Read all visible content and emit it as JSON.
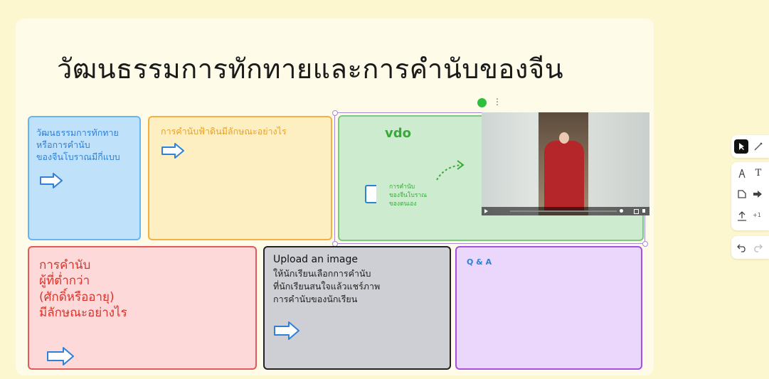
{
  "board": {
    "title": "วัฒนธรรมการทักทายและการคำนับของจีน"
  },
  "cards": {
    "blue": {
      "text": "วัฒนธรรมการทักทาย\nหรือการคำนับ\nของจีนโบราณมีกี่แบบ"
    },
    "orange": {
      "text": "การคำนับฟ้าดินมีลักษณะอย่างไร"
    },
    "green": {
      "heading": "vdo",
      "note": "การคำนับ\nของจีนโบราณ\nของตนเอง"
    },
    "red": {
      "text": "การคำนับ\nผู้ที่ต่ำกว่า\n(ศักดิ์หรืออายุ)\nมีลักษณะอย่างไร"
    },
    "gray": {
      "heading": "Upload an image",
      "text": "ให้นักเรียนเลือกการคำนับ\nที่นักเรียนสนใจแล้วแชร์ภาพ\nการคำนับของนักเรียน"
    },
    "purple": {
      "heading": "Q & A"
    }
  },
  "selection": {
    "more_label": "⋮"
  },
  "toolbar": {
    "text_tool": "T",
    "count_badge": "+1"
  },
  "colors": {
    "board": "#fefbe8",
    "background": "#fdf7cf",
    "blue_text": "#2f80d8",
    "orange_text": "#e9a126",
    "green_text": "#3aa93a",
    "red_text": "#d9342b",
    "purple_text": "#8a3bd0"
  }
}
